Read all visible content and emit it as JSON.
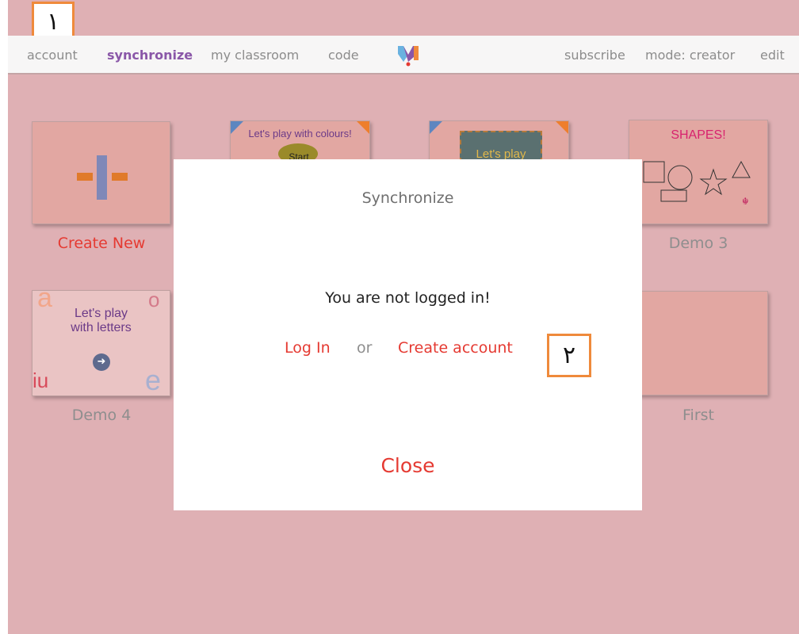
{
  "annotations": {
    "box1": "١",
    "box2": "٢"
  },
  "nav": {
    "account": "account",
    "synchronize": "synchronize",
    "classroom": "my classroom",
    "code": "code",
    "subscribe": "subscribe",
    "mode": "mode: creator",
    "edit": "edit"
  },
  "tiles": [
    {
      "label": "Create New"
    },
    {
      "thumb_text": "Let's play with colours!",
      "thumb_start": "Start"
    },
    {
      "thumb_text": "Let's play"
    },
    {
      "label": "Demo 3",
      "thumb_title": "SHAPES!"
    },
    {
      "label": "Demo 4",
      "thumb_text_1": "Let's play",
      "thumb_text_2": "with letters",
      "thumb_letters": [
        "a",
        "o",
        "iu",
        "e"
      ]
    },
    {
      "label": "First"
    }
  ],
  "modal": {
    "title": "Synchronize",
    "message": "You are not logged in!",
    "login": "Log In",
    "or": "or",
    "create_account": "Create account",
    "close": "Close"
  },
  "colors": {
    "background": "#dfb0b4",
    "accent_red": "#e53a32",
    "accent_purple": "#8a57a8",
    "annotation_orange": "#ef8a3b"
  }
}
